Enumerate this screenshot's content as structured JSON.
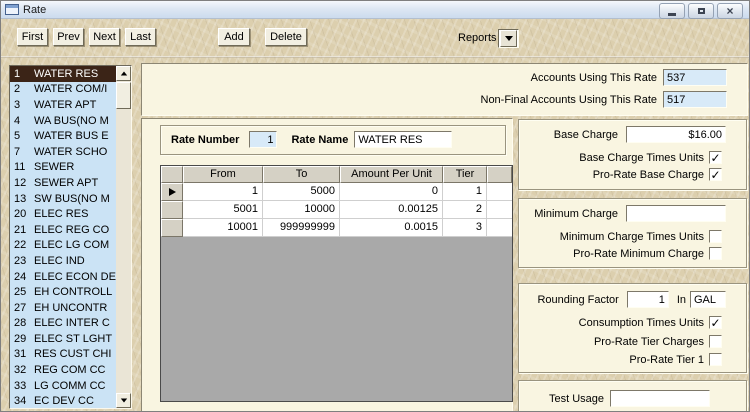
{
  "window": {
    "title": "Rate"
  },
  "toolbar": {
    "first_label": "First",
    "prev_label": "Prev",
    "next_label": "Next",
    "last_label": "Last",
    "add_label": "Add",
    "delete_label": "Delete",
    "reports_label": "Reports"
  },
  "icons": {
    "window_icon": "form-icon",
    "reports_dropdown": "chevron-down",
    "scroll_up": "up-arrow",
    "scroll_down": "down-arrow",
    "row_selector": "right-arrow",
    "checkmark": "check"
  },
  "rate_list": {
    "selected_index": 0,
    "items": [
      {
        "num": "1",
        "name": "WATER RES"
      },
      {
        "num": "2",
        "name": "WATER COM/I"
      },
      {
        "num": "3",
        "name": "WATER APT"
      },
      {
        "num": "4",
        "name": "WA BUS(NO M"
      },
      {
        "num": "5",
        "name": "WATER BUS E"
      },
      {
        "num": "7",
        "name": "WATER SCHO"
      },
      {
        "num": "11",
        "name": "SEWER"
      },
      {
        "num": "12",
        "name": "SEWER APT"
      },
      {
        "num": "13",
        "name": "SW BUS(NO M"
      },
      {
        "num": "20",
        "name": "ELEC RES"
      },
      {
        "num": "21",
        "name": "ELEC REG CO"
      },
      {
        "num": "22",
        "name": "ELEC LG COM"
      },
      {
        "num": "23",
        "name": "ELEC IND"
      },
      {
        "num": "24",
        "name": "ELEC ECON DE"
      },
      {
        "num": "25",
        "name": "EH CONTROLL"
      },
      {
        "num": "27",
        "name": "EH UNCONTR"
      },
      {
        "num": "28",
        "name": "ELEC INTER C"
      },
      {
        "num": "29",
        "name": "ELEC ST LGHT"
      },
      {
        "num": "31",
        "name": "RES CUST CHI"
      },
      {
        "num": "32",
        "name": "REG COM CC"
      },
      {
        "num": "33",
        "name": "LG COMM CC"
      },
      {
        "num": "34",
        "name": "EC DEV CC"
      }
    ]
  },
  "summary": {
    "accounts_using_label": "Accounts Using This Rate",
    "accounts_using_value": "537",
    "non_final_label": "Non-Final Accounts Using This Rate",
    "non_final_value": "517"
  },
  "rate_identity": {
    "rate_number_label": "Rate Number",
    "rate_number_value": "1",
    "rate_name_label": "Rate Name",
    "rate_name_value": "WATER RES"
  },
  "tier_grid": {
    "columns": [
      "From",
      "To",
      "Amount Per Unit",
      "Tier"
    ],
    "rows": [
      [
        "1",
        "5000",
        "0",
        "1"
      ],
      [
        "5001",
        "10000",
        "0.00125",
        "2"
      ],
      [
        "10001",
        "999999999",
        "0.0015",
        "3"
      ]
    ],
    "selected_row": 0
  },
  "base_charge_group": {
    "label": "Base Charge",
    "value": "$16.00",
    "times_units_label": "Base Charge Times Units",
    "times_units_checked": true,
    "pro_rate_label": "Pro-Rate Base Charge",
    "pro_rate_checked": true
  },
  "minimum_charge_group": {
    "label": "Minimum Charge",
    "value": "",
    "times_units_label": "Minimum Charge Times Units",
    "times_units_checked": false,
    "pro_rate_label": "Pro-Rate Minimum Charge",
    "pro_rate_checked": false
  },
  "rounding_group": {
    "label": "Rounding Factor",
    "value": "1",
    "in_label": "In",
    "in_value": "GAL",
    "consumption_label": "Consumption Times Units",
    "consumption_checked": true,
    "pro_rate_tier_label": "Pro-Rate Tier Charges",
    "pro_rate_tier_checked": false,
    "pro_rate_tier1_label": "Pro-Rate Tier 1",
    "pro_rate_tier1_checked": false
  },
  "test_usage_group": {
    "label": "Test Usage",
    "value": ""
  },
  "colors": {
    "panel": "#f9f5e1",
    "texture_base": "#dccfae",
    "list_bg": "#cbe3f5",
    "list_selected_bg": "#3b2417",
    "list_selected_fg": "#ffffff",
    "grid_header": "#d5d1c5",
    "grid_empty": "#a9a9a9",
    "field_blue": "#d8eaf8"
  }
}
